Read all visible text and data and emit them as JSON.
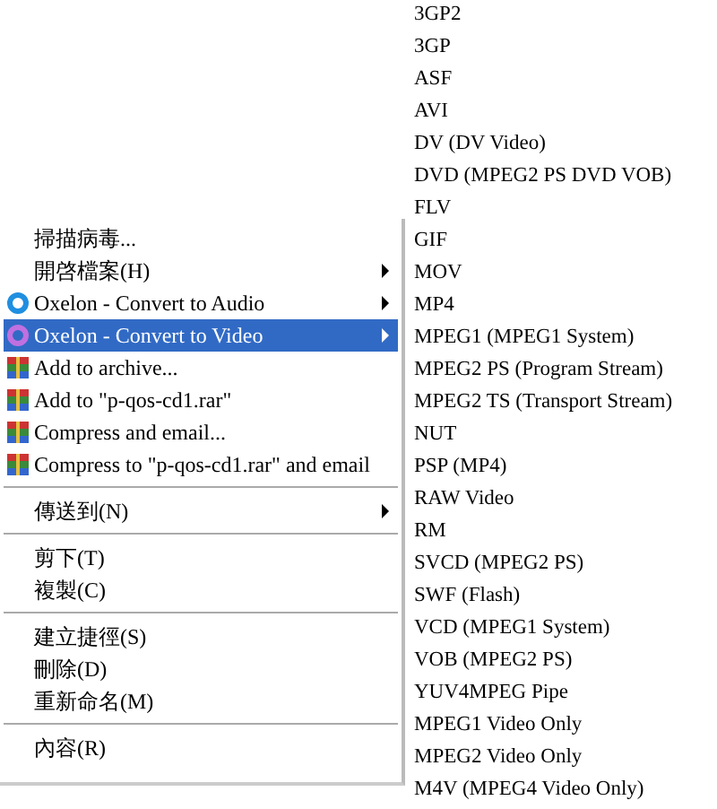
{
  "context_menu": {
    "items": [
      {
        "kind": "plain",
        "label": "掃描病毒...",
        "has_submenu": false,
        "selected": false
      },
      {
        "kind": "plain",
        "label": "開啓檔案(H)",
        "has_submenu": true,
        "selected": false
      },
      {
        "kind": "ring",
        "color": "#1f8fe0",
        "label": "Oxelon - Convert to Audio",
        "has_submenu": true,
        "selected": false
      },
      {
        "kind": "ring",
        "color": "#c070e0",
        "label": "Oxelon - Convert to Video",
        "has_submenu": true,
        "selected": true
      },
      {
        "kind": "archive",
        "label": "Add to archive...",
        "has_submenu": false,
        "selected": false
      },
      {
        "kind": "archive",
        "label": "Add to \"p-qos-cd1.rar\"",
        "has_submenu": false,
        "selected": false
      },
      {
        "kind": "archive",
        "label": "Compress and email...",
        "has_submenu": false,
        "selected": false
      },
      {
        "kind": "archive",
        "label": "Compress to \"p-qos-cd1.rar\" and email",
        "has_submenu": false,
        "selected": false
      },
      {
        "kind": "separator"
      },
      {
        "kind": "plain",
        "label": "傳送到(N)",
        "has_submenu": true,
        "selected": false
      },
      {
        "kind": "separator"
      },
      {
        "kind": "plain",
        "label": "剪下(T)",
        "has_submenu": false,
        "selected": false
      },
      {
        "kind": "plain",
        "label": "複製(C)",
        "has_submenu": false,
        "selected": false
      },
      {
        "kind": "separator"
      },
      {
        "kind": "plain",
        "label": "建立捷徑(S)",
        "has_submenu": false,
        "selected": false
      },
      {
        "kind": "plain",
        "label": "刪除(D)",
        "has_submenu": false,
        "selected": false
      },
      {
        "kind": "plain",
        "label": "重新命名(M)",
        "has_submenu": false,
        "selected": false
      },
      {
        "kind": "separator"
      },
      {
        "kind": "plain",
        "label": "內容(R)",
        "has_submenu": false,
        "selected": false
      }
    ]
  },
  "submenu": {
    "items": [
      "3GP2",
      "3GP",
      "ASF",
      "AVI",
      "DV (DV Video)",
      "DVD (MPEG2 PS DVD VOB)",
      "FLV",
      "GIF",
      "MOV",
      "MP4",
      "MPEG1 (MPEG1 System)",
      "MPEG2 PS (Program Stream)",
      "MPEG2 TS (Transport Stream)",
      "NUT",
      "PSP (MP4)",
      "RAW Video",
      "RM",
      "SVCD (MPEG2 PS)",
      "SWF (Flash)",
      "VCD (MPEG1 System)",
      "VOB (MPEG2 PS)",
      "YUV4MPEG Pipe",
      "MPEG1 Video Only",
      "MPEG2 Video Only",
      "M4V (MPEG4 Video Only)"
    ]
  }
}
